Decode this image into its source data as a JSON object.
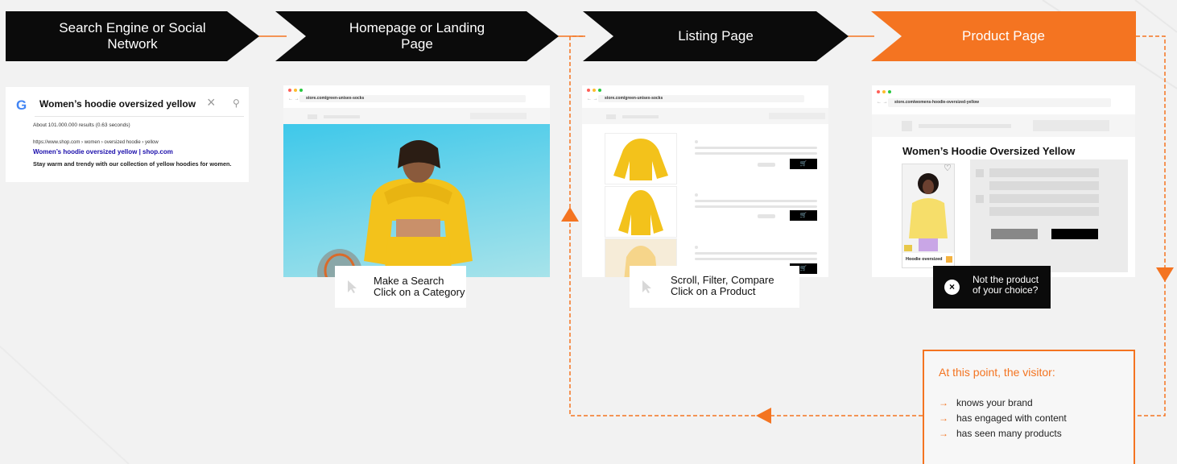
{
  "steps": [
    {
      "label": "Search Engine or Social Network"
    },
    {
      "label": "Homepage or Landing Page"
    },
    {
      "label": "Listing Page"
    },
    {
      "label": "Product Page"
    }
  ],
  "google": {
    "logo": "G",
    "query": "Women’s hoodie oversized yellow",
    "clear": "×",
    "search_glyph": "⚲",
    "about": "About 101.000.000 results (0.63 seconds)",
    "url": "https://www.shop.com › women › oversized hoodie › yellow",
    "title": "Women’s hoodie oversized yellow | shop.com",
    "description": "Stay warm and trendy with our collection of yellow hoodies for women."
  },
  "homepage": {
    "url": "store.com/green-unisex-socks",
    "caption_line1": "Make a Search",
    "caption_line2": "Click on a Category"
  },
  "listing": {
    "url": "store.com/green-unisex-socks",
    "cart_glyph": "🛒",
    "caption_line1": "Scroll, Filter, Compare",
    "caption_line2": "Click on a Product"
  },
  "product": {
    "url": "store.com/womens-hoodie-oversized-yellow",
    "title": "Women’s Hoodie Oversized Yellow",
    "thumb_label": "Hoodie oversized",
    "heart": "♡",
    "nochoice_line1": "Not the product",
    "nochoice_line2": "of your choice?",
    "close_glyph": "×"
  },
  "visitor": {
    "title": "At this point, the visitor:",
    "arrow": "→",
    "items": [
      "knows your brand",
      "has engaged with content",
      "has seen many products"
    ]
  },
  "colors": {
    "accent": "#f47421",
    "dark": "#0b0b0b",
    "background": "#f2f2f2",
    "hoodie": "#f3c21b",
    "sky": "#3ec8ea"
  }
}
